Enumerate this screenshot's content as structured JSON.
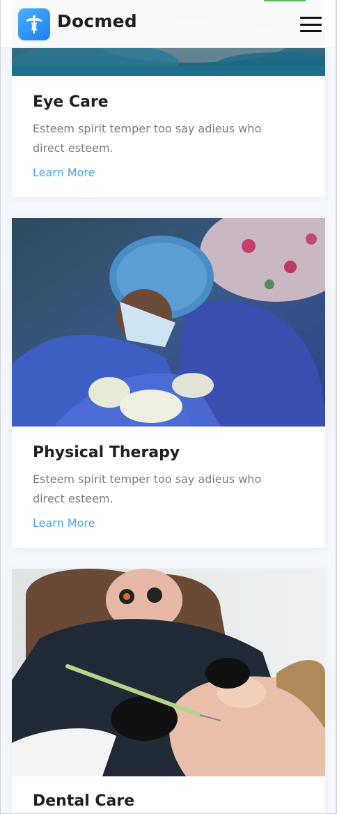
{
  "header": {
    "brand": "Docmed",
    "logo_icon": "caduceus-icon",
    "menu_icon": "hamburger-menu-icon",
    "accent_color": "#5cb85c",
    "logo_color": "#2f95fb"
  },
  "services": [
    {
      "title": "Eye Care",
      "description": "Esteem spirit temper too say adieus who direct esteem.",
      "link_label": "Learn More",
      "image": "surgery-photo"
    },
    {
      "title": "Physical Therapy",
      "description": "Esteem spirit temper too say adieus who direct esteem.",
      "link_label": "Learn More",
      "image": "surgeons-operating-photo"
    },
    {
      "title": "Dental Care",
      "description": "",
      "link_label": "",
      "image": "dentist-patient-photo"
    }
  ],
  "colors": {
    "link": "#4aa3e6",
    "title": "#1f1f1f",
    "text": "#7b7b7b",
    "background": "#f4f8fc"
  }
}
